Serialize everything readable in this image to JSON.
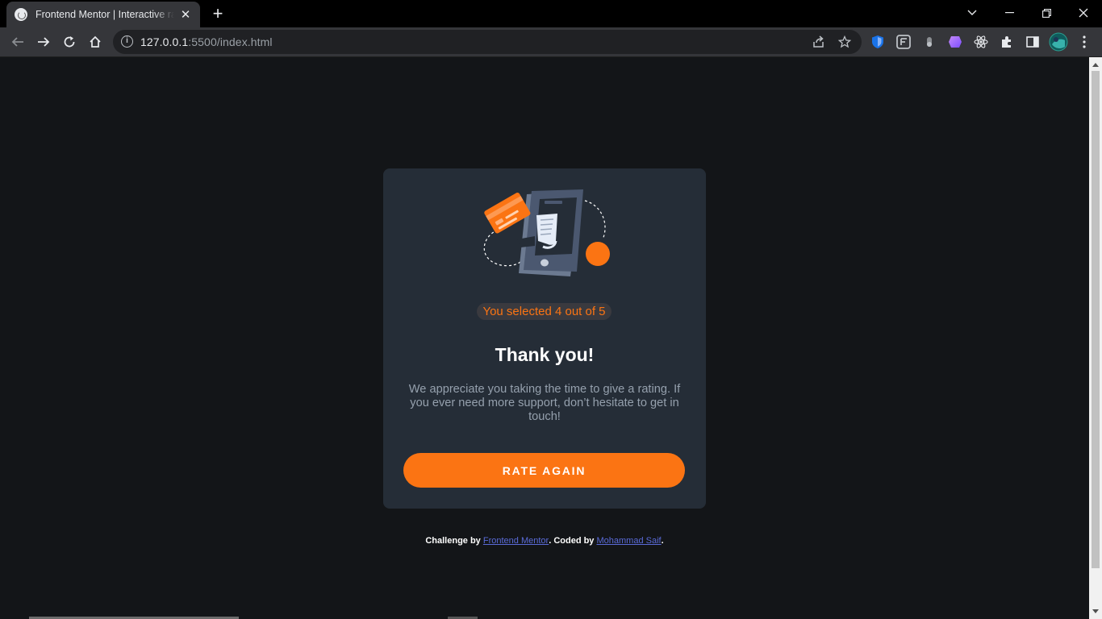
{
  "browser": {
    "tab_title": "Frontend Mentor | Interactive rating component",
    "new_tab_label": "+",
    "url_host": "127.0.0.1",
    "url_path": ":5500/index.html"
  },
  "card": {
    "selection_text": "You selected 4 out of 5",
    "selected_rating": 4,
    "max_rating": 5,
    "heading": "Thank you!",
    "message": "We appreciate you taking the time to give a rating. If you ever need more support, don’t hesitate to get in touch!",
    "button_label": "RATE AGAIN"
  },
  "attribution": {
    "prefix": "Challenge by",
    "link1": "Frontend Mentor",
    "middle": ". Coded by",
    "link2": "Mohammad Saif",
    "suffix": "."
  },
  "colors": {
    "background": "#131518",
    "card": "#252d37",
    "accent": "#fb7413",
    "heading": "#ffffff",
    "body_text": "#95a0ad",
    "link": "#5a6bd8"
  }
}
